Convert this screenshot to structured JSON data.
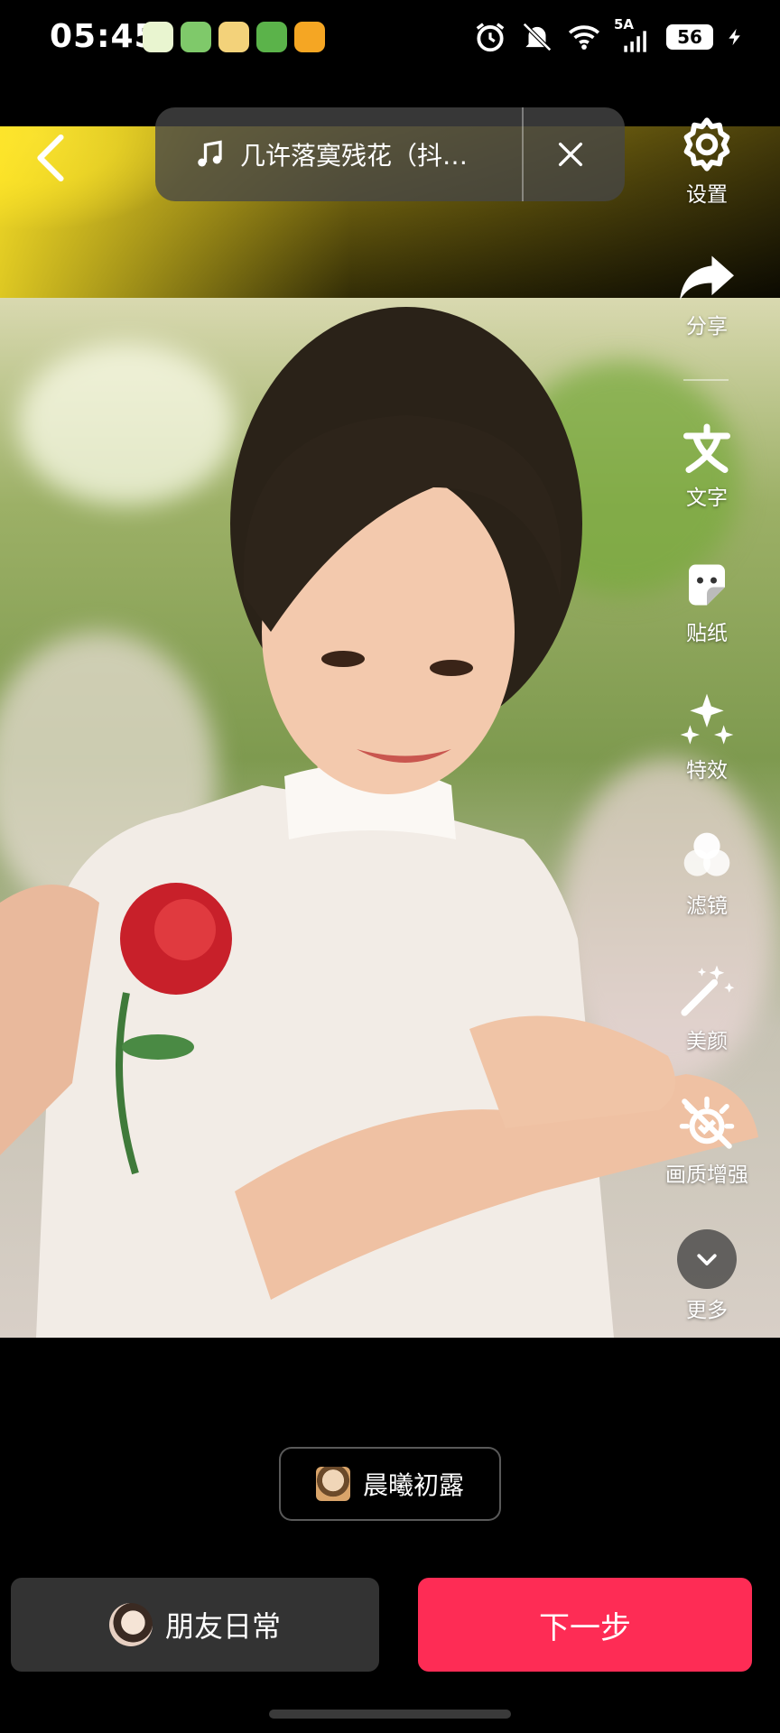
{
  "status_bar": {
    "time": "05:45",
    "network_label": "5A",
    "battery": "56",
    "app_icons": [
      "alipay-icon",
      "wechat-style-icon",
      "weibo-icon",
      "app-green-icon",
      "app-orange-icon"
    ],
    "system_icons": [
      "alarm-icon",
      "mute-icon",
      "wifi-icon",
      "signal-icon",
      "battery-icon",
      "charging-icon"
    ]
  },
  "music": {
    "title": "几许落寞残花（抖…",
    "icon": "music-note-icon",
    "close_icon": "close-icon"
  },
  "toolbar": {
    "settings": "设置",
    "share": "分享",
    "text": "文字",
    "sticker": "贴纸",
    "effects": "特效",
    "filter": "滤镜",
    "beauty": "美颜",
    "enhance": "画质增强",
    "more": "更多"
  },
  "template": {
    "label": "晨曦初露"
  },
  "bottom": {
    "friends_label": "朋友日常",
    "next_label": "下一步"
  },
  "colors": {
    "accent": "#fe2c55",
    "secondary_button": "#333333",
    "background": "#000000"
  }
}
